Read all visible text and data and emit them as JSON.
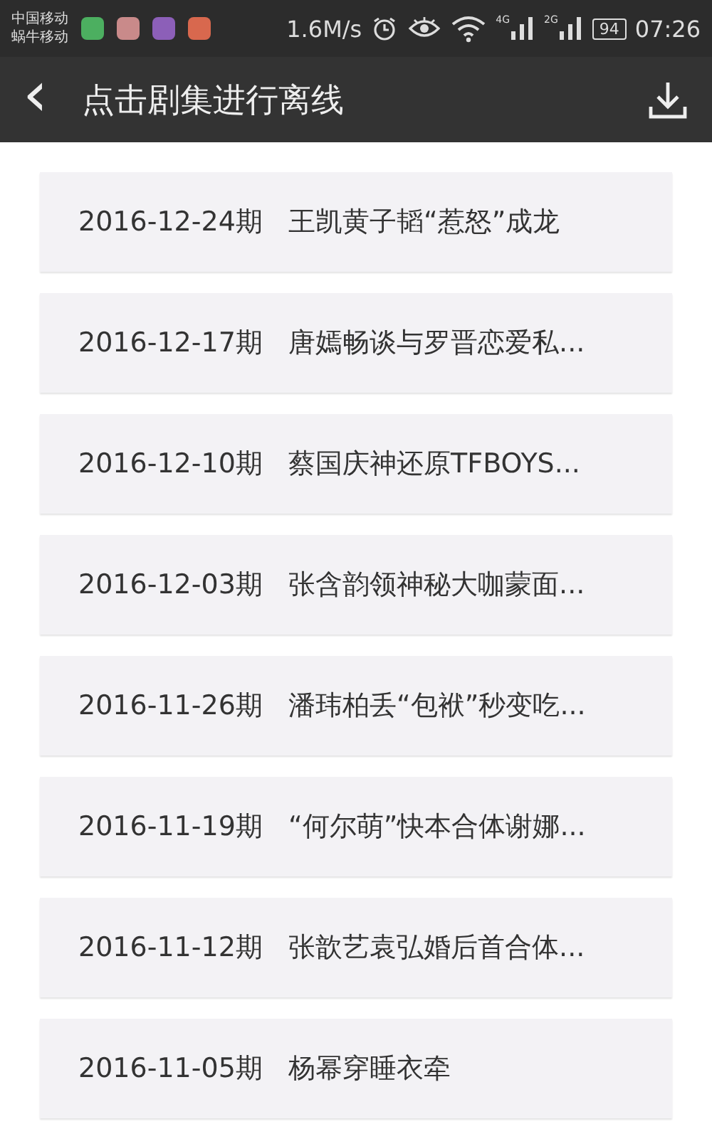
{
  "status_bar": {
    "carriers": [
      "中国移动",
      "蜗牛移动"
    ],
    "app_icons": [
      {
        "color": "#4caf60"
      },
      {
        "color": "#c98a8a"
      },
      {
        "color": "#8c5fb8"
      },
      {
        "color": "#d8684e"
      }
    ],
    "speed": "1.6M/s",
    "signals": [
      "4G",
      "2G"
    ],
    "battery": "94",
    "time": "07:26"
  },
  "header": {
    "back": "‹",
    "title": "点击剧集进行离线"
  },
  "episodes": [
    {
      "date": "2016-12-24期",
      "title": "王凯黄子韬“惹怒”成龙"
    },
    {
      "date": "2016-12-17期",
      "title": "唐嫣畅谈与罗晋恋爱私..."
    },
    {
      "date": "2016-12-10期",
      "title": "蔡国庆神还原TFBOYS..."
    },
    {
      "date": "2016-12-03期",
      "title": "张含韵领神秘大咖蒙面..."
    },
    {
      "date": "2016-11-26期",
      "title": "潘玮柏丢“包袱”秒变吃..."
    },
    {
      "date": "2016-11-19期",
      "title": "“何尔萌”快本合体谢娜..."
    },
    {
      "date": "2016-11-12期",
      "title": "张歆艺袁弘婚后首合体..."
    },
    {
      "date": "2016-11-05期",
      "title": "杨幂穿睡衣牵"
    }
  ]
}
